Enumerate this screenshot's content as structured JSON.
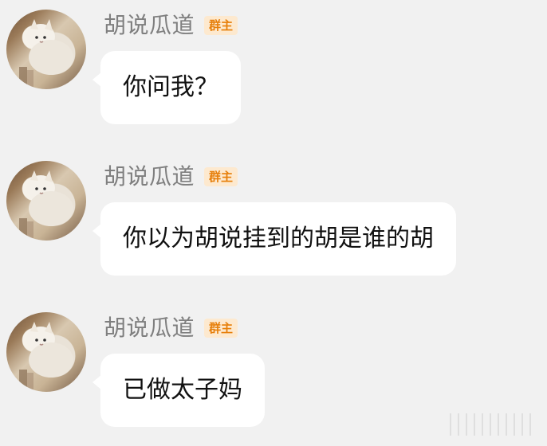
{
  "messages": [
    {
      "sender": "胡说瓜道",
      "badge": "群主",
      "text": "你问我？"
    },
    {
      "sender": "胡说瓜道",
      "badge": "群主",
      "text": "你以为胡说挂到的胡是谁的胡"
    },
    {
      "sender": "胡说瓜道",
      "badge": "群主",
      "text": "已做太子妈"
    }
  ],
  "colors": {
    "background": "#f1f1f1",
    "bubble": "#ffffff",
    "name": "#7f7f7f",
    "badge_bg": "#fde9cf",
    "badge_text": "#e77f0a"
  }
}
